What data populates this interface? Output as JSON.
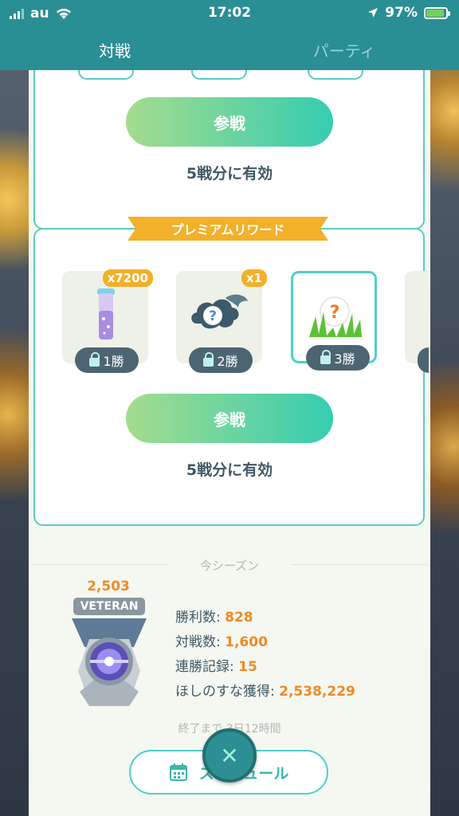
{
  "status_bar": {
    "carrier": "au",
    "time": "17:02",
    "battery": "97%"
  },
  "tabs": [
    {
      "label": "対戦"
    },
    {
      "label": "パーティ"
    }
  ],
  "card1": {
    "join_label": "参戦",
    "valid_text": "5戦分に有効"
  },
  "premium": {
    "ribbon": "プレミアムリワード",
    "rewards": [
      {
        "count": "x7200",
        "lock": "1勝",
        "icon": "stardust-icon"
      },
      {
        "count": "x1",
        "lock": "2勝",
        "icon": "mystery-cloud-icon"
      },
      {
        "count": "",
        "lock": "3勝",
        "icon": "mystery-grass-encounter-icon"
      }
    ],
    "join_label": "参戦",
    "valid_text": "5戦分に有効"
  },
  "season": {
    "label": "今シーズン",
    "rating": "2,503",
    "rank": "VETERAN",
    "stats": [
      {
        "label": "勝利数: ",
        "value": "828"
      },
      {
        "label": "対戦数: ",
        "value": "1,600"
      },
      {
        "label": "連勝記録: ",
        "value": "15"
      },
      {
        "label": "ほしのすな獲得: ",
        "value": "2,538,229"
      }
    ],
    "ends_text": "終了まで 3日12時間"
  },
  "schedule_label": "スケジュール",
  "close_symbol": "✕"
}
